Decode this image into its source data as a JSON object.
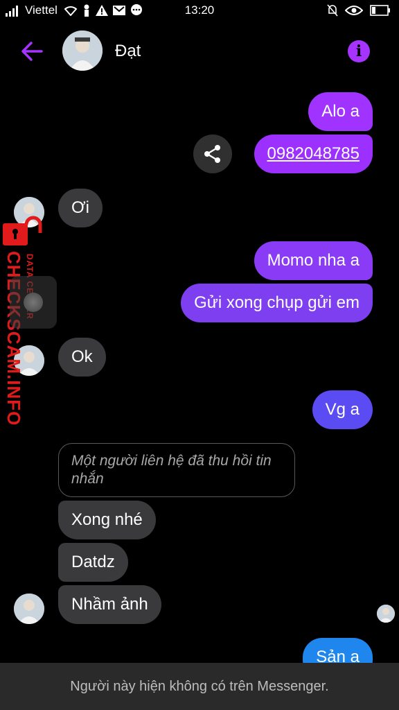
{
  "status_bar": {
    "carrier": "Viettel",
    "time": "13:20"
  },
  "header": {
    "contact_name": "Đạt"
  },
  "messages": {
    "m1": "Alo a",
    "m2": "0982048785",
    "m3": "Ơi",
    "m4": "Momo nha a",
    "m5": "Gửi xong chụp gửi em",
    "m6": "Ok",
    "m7": "Vg a",
    "recalled": "Một người liên hệ đã thu hồi tin nhắn",
    "m8": "Xong nhé",
    "m9": "Datdz",
    "m10": "Nhầm ảnh",
    "m11": "Sản a"
  },
  "watermark": {
    "main": "CHECKSCAM.INFO",
    "sub": "DATA CENTER"
  },
  "footer": {
    "notice": "Người này hiện không có trên Messenger."
  },
  "colors": {
    "accent": "#a633ff",
    "outgoing_blue": "#1f86ee",
    "incoming": "#3a3a3c"
  }
}
